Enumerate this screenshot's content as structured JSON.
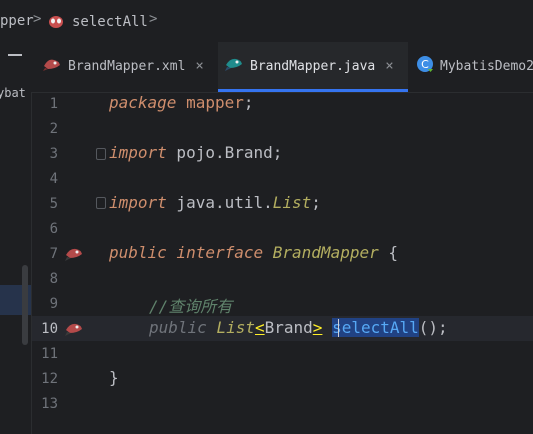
{
  "breadcrumb": {
    "segment_1": "pper",
    "separator": ">",
    "segment_2": "selectAll",
    "segment_2_icon": "mapper-bird-icon"
  },
  "project_panel": {
    "collapse_symbol": "−",
    "label": "ybat"
  },
  "tabs": [
    {
      "label": "BrandMapper.xml",
      "icon": "mybatis-bird-icon",
      "close": "×"
    },
    {
      "label": "BrandMapper.java",
      "icon": "mybatis-bird-icon",
      "close": "×",
      "active": true
    },
    {
      "label": "MybatisDemo2",
      "icon": "java-class-icon"
    }
  ],
  "editor": {
    "line_numbers": [
      "1",
      "2",
      "3",
      "4",
      "5",
      "6",
      "7",
      "8",
      "9",
      "10",
      "11",
      "12",
      "13"
    ],
    "current_line": 10,
    "lines": {
      "l1_kw": "package",
      "l1_name": " mapper",
      "l1_end": ";",
      "l3_kw": "import",
      "l3_name": " pojo.Brand",
      "l3_end": ";",
      "l5_kw": "import",
      "l5_pkg": " java.util.",
      "l5_type": "List",
      "l5_end": ";",
      "l7_kw1": "public",
      "l7_kw2": " interface ",
      "l7_name": "BrandMapper",
      "l7_end": " {",
      "l9_comment": "//查询所有",
      "l10_mod": "public",
      "l10_type": "List",
      "l10_lt": "<",
      "l10_generic": "Brand",
      "l10_gt": ">",
      "l10_method": "selectAll",
      "l10_end": "();",
      "l12": "}"
    }
  },
  "colors": {
    "background": "#1e1f22",
    "accent": "#3574f0",
    "keyword": "#cf8e6d",
    "method": "#56a8f5",
    "comment": "#5f826b"
  }
}
